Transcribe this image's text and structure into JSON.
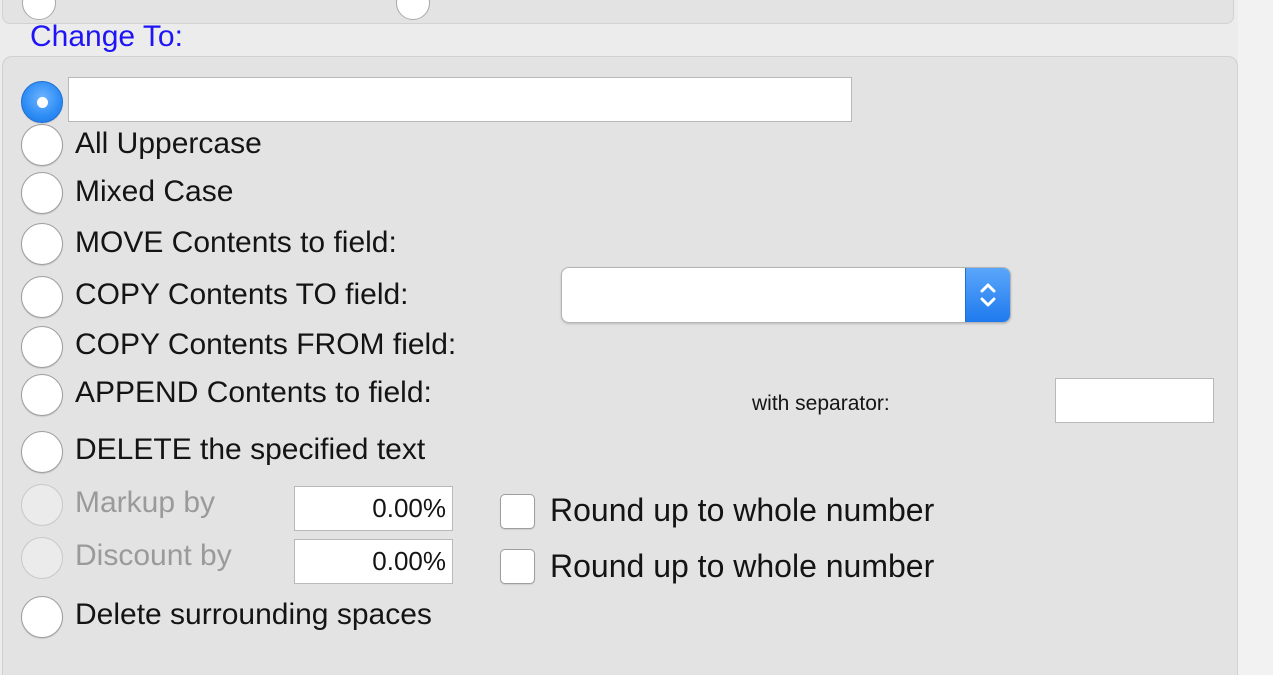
{
  "section": {
    "title": "Change To:"
  },
  "options": {
    "custom": {
      "selected": true,
      "value": ""
    },
    "all_uppercase": {
      "label": "All Uppercase",
      "selected": false
    },
    "mixed_case": {
      "label": "Mixed Case",
      "selected": false
    },
    "move_contents": {
      "label": "MOVE Contents to field:",
      "selected": false
    },
    "copy_to": {
      "label": "COPY Contents TO field:",
      "selected": false
    },
    "copy_from": {
      "label": "COPY Contents FROM field:",
      "selected": false
    },
    "append": {
      "label": "APPEND Contents to field:",
      "selected": false
    },
    "delete_text": {
      "label": "DELETE the specified text",
      "selected": false
    },
    "markup": {
      "label": "Markup by",
      "value": "0.00%",
      "enabled": false,
      "round_label": "Round up to whole number",
      "round_checked": false
    },
    "discount": {
      "label": "Discount by",
      "value": "0.00%",
      "enabled": false,
      "round_label": "Round up to whole number",
      "round_checked": false
    },
    "delete_spaces": {
      "label": "Delete surrounding spaces",
      "selected": false
    }
  },
  "field_popup": {
    "selected_value": "",
    "icon": "chevron-up-down-icon"
  },
  "separator": {
    "label": "with separator:",
    "value": ""
  },
  "colors": {
    "title": "#1e14f5",
    "accent": "#2c8cf5",
    "disabled_text": "#9a9a9a",
    "panel": "#e3e3e3"
  }
}
